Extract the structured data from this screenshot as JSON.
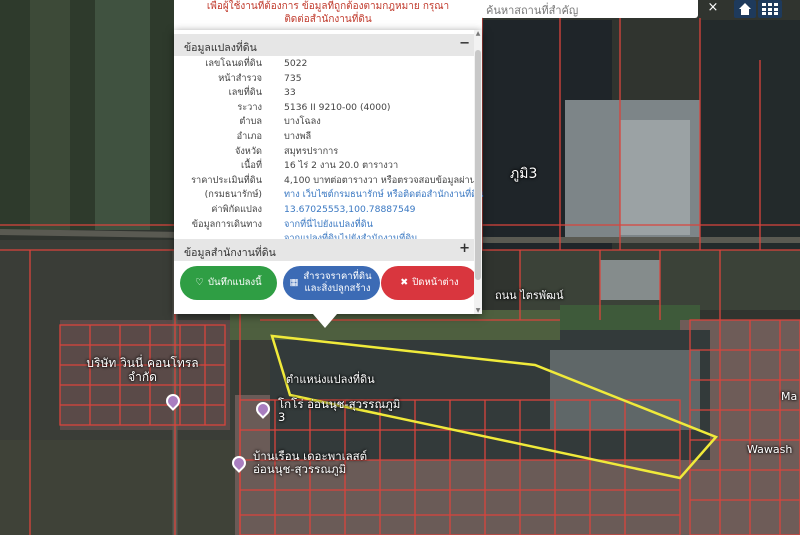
{
  "notice": {
    "line1": "เพื่อผู้ใช้งานที่ต้องการ ข้อมูลที่ถูกต้องตามกฎหมาย กรุณา",
    "line2": "ติดต่อสำนักงานที่ดิน"
  },
  "search": {
    "placeholder": "ค้นหาสถานที่สำคัญ",
    "clear": "×"
  },
  "map_buttons": {
    "home_icon": "house-icon",
    "grid_icon": "grid-icon"
  },
  "popup": {
    "section1_title": "ข้อมูลแปลงที่ดิน",
    "section1_toggle": "−",
    "details": [
      {
        "label": "เลขโฉนดที่ดิน",
        "value": "5022"
      },
      {
        "label": "หน้าสำรวจ",
        "value": "735"
      },
      {
        "label": "เลขที่ดิน",
        "value": "33"
      },
      {
        "label": "ระวาง",
        "value": "5136 II 9210-00 (4000)"
      },
      {
        "label": "ตำบล",
        "value": "บางโฉลง"
      },
      {
        "label": "อำเภอ",
        "value": "บางพลี"
      },
      {
        "label": "จังหวัด",
        "value": "สมุทรปราการ"
      },
      {
        "label": "เนื้อที่",
        "value": "16 ไร่ 2 งาน 20.0 ตารางวา"
      },
      {
        "label": "ราคาประเมินที่ดิน",
        "value": "4,100 บาทต่อตารางวา หรือตรวจสอบข้อมูลผ่าน"
      },
      {
        "label": "(กรมธนารักษ์)",
        "value": "ทาง เว็บไซต์กรมธนารักษ์ หรือติดต่อสำนักงานที่ดิน"
      },
      {
        "label": "ค่าพิกัดแปลง",
        "value": "13.67025553,100.78887549"
      },
      {
        "label": "ข้อมูลการเดินทาง",
        "value": "จากที่นี่ไปยังแปลงที่ดิน"
      },
      {
        "label": "",
        "value": "จากแปลงที่ดินไปยังสำนักงานที่ดิน"
      }
    ],
    "section2_title": "ข้อมูลสำนักงานที่ดิน",
    "section2_toggle": "+",
    "buttons": {
      "save": "บันทึกแปลงนี้",
      "places": "สำรวจราคาที่ดินและสิ่งปลูกสร้าง",
      "close": "ปิดหน้าต่าง"
    }
  },
  "map_labels": {
    "parcel": "ตำแหน่งแปลงที่ดิน",
    "poi1": "บริษัท วินนี่ คอนโทรล จำกัด",
    "poi2": "โกโร่ อ่อนนุช-สุวรรณภูมิ 3",
    "poi3": "บ้านเรือน เดอะพาเลสต์ อ่อนนุช-สุวรรณภูมิ",
    "area_right": "ภูมิ3",
    "road": "ถนน ไตรพัฒน์",
    "edge1": "Wawash",
    "edge2": "Ma"
  }
}
